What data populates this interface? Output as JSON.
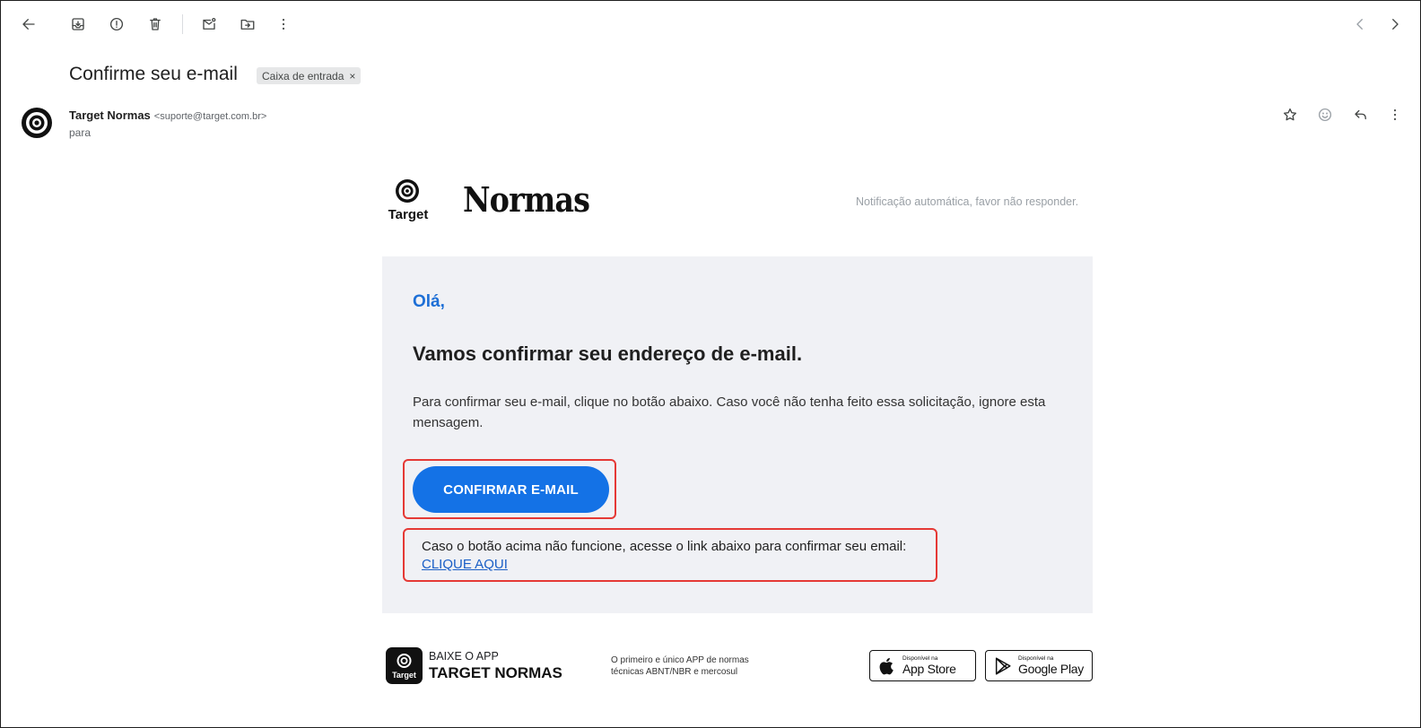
{
  "subject": {
    "title": "Confirme seu e-mail",
    "label": "Caixa de entrada",
    "label_remove": "×"
  },
  "sender": {
    "name": "Target Normas",
    "address": "<suporte@target.com.br>",
    "to": "para"
  },
  "email": {
    "brand_logo_text": "Target",
    "brand_name": "Normas",
    "notice": "Notificação automática, favor não responder.",
    "greeting": "Olá,",
    "headline": "Vamos confirmar seu endereço de e-mail.",
    "body": "Para confirmar seu e-mail, clique no botão abaixo. Caso você não tenha feito essa solicitação, ignore esta mensagem.",
    "cta_label": "CONFIRMAR E-MAIL",
    "fallback_text": "Caso o botão acima não funcione, acesse o link abaixo para confirmar seu email:",
    "fallback_link": "CLIQUE AQUI"
  },
  "footer": {
    "app_icon_text": "Target",
    "app_top": "BAIXE O APP",
    "app_name": "TARGET NORMAS",
    "app_desc": "O primeiro e único APP de normas técnicas ABNT/NBR e mercosul",
    "appstore_small": "Disponível na",
    "appstore_big": "App Store",
    "googleplay_small": "Disponível na",
    "googleplay_big": "Google Play"
  },
  "colors": {
    "accent": "#1472e6",
    "greeting": "#1d6fd6",
    "highlight": "#e53935",
    "card": "#f0f1f5"
  }
}
